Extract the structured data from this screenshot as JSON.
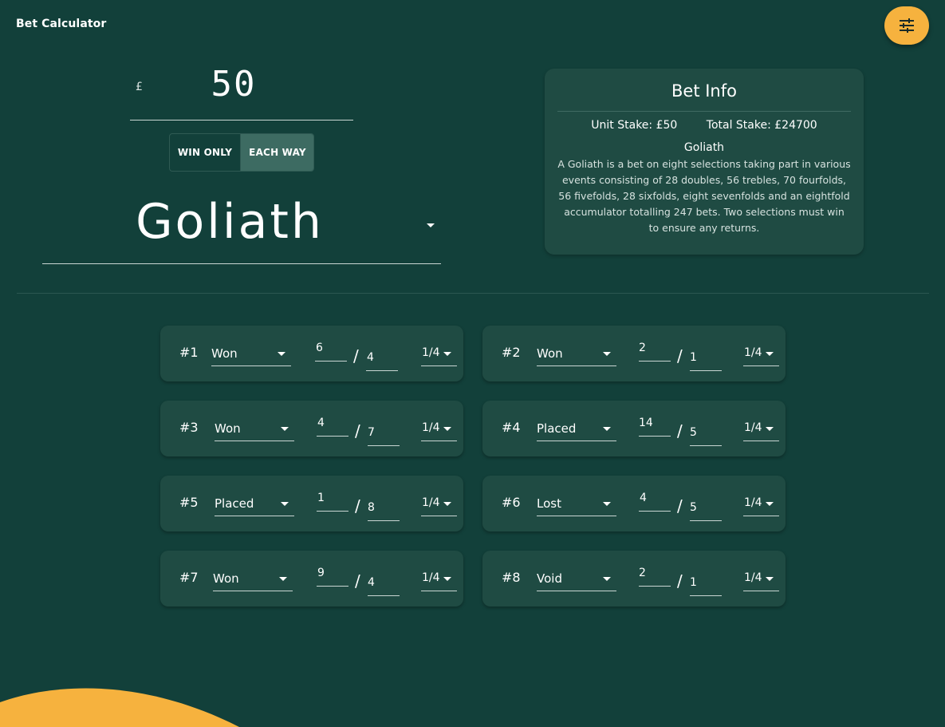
{
  "header": {
    "title": "Bet Calculator",
    "settings_icon": "tune-sliders-icon"
  },
  "stake": {
    "currency": "£",
    "value": "50"
  },
  "toggle": {
    "win_only": "WIN ONLY",
    "each_way": "EACH WAY",
    "selected": "EACH WAY"
  },
  "bet_type": {
    "value": "Goliath"
  },
  "bet_info": {
    "title": "Bet Info",
    "unit_stake": "Unit Stake: £50",
    "total_stake": "Total Stake: £24700",
    "name": "Goliath",
    "description": "A Goliath is a bet on eight selections taking part in various events consisting of 28 doubles, 56 trebles, 70 fourfolds, 56 fivefolds, 28 sixfolds, eight sevenfolds and an eightfold accumulator totalling 247 bets. Two selections must win to ensure any returns."
  },
  "selections": [
    {
      "num": "#1",
      "status": "Won",
      "odds_num": "6",
      "odds_den": "4",
      "each_way": "1/4"
    },
    {
      "num": "#2",
      "status": "Won",
      "odds_num": "2",
      "odds_den": "1",
      "each_way": "1/4"
    },
    {
      "num": "#3",
      "status": "Won",
      "odds_num": "4",
      "odds_den": "7",
      "each_way": "1/4"
    },
    {
      "num": "#4",
      "status": "Placed",
      "odds_num": "14",
      "odds_den": "5",
      "each_way": "1/4"
    },
    {
      "num": "#5",
      "status": "Placed",
      "odds_num": "1",
      "odds_den": "8",
      "each_way": "1/4"
    },
    {
      "num": "#6",
      "status": "Lost",
      "odds_num": "4",
      "odds_den": "5",
      "each_way": "1/4"
    },
    {
      "num": "#7",
      "status": "Won",
      "odds_num": "9",
      "odds_den": "4",
      "each_way": "1/4"
    },
    {
      "num": "#8",
      "status": "Void",
      "odds_num": "2",
      "odds_den": "1",
      "each_way": "1/4"
    }
  ],
  "colors": {
    "background": "#12403a",
    "card": "#1f4b43",
    "accent": "#f6b23e",
    "selected_toggle": "#3d6b62"
  }
}
